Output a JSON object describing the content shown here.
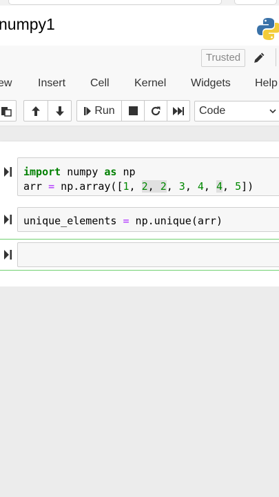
{
  "notebook": {
    "title": "numpy1"
  },
  "status": {
    "trusted_label": "Trusted"
  },
  "menu": [
    {
      "label": "ew"
    },
    {
      "label": "Insert"
    },
    {
      "label": "Cell"
    },
    {
      "label": "Kernel"
    },
    {
      "label": "Widgets"
    },
    {
      "label": "Help"
    }
  ],
  "toolbar": {
    "run_label": "Run",
    "cell_type": "Code"
  },
  "cells": [
    {
      "lines": [
        [
          {
            "t": "import",
            "c": "kw"
          },
          {
            "t": " numpy ",
            "c": ""
          },
          {
            "t": "as",
            "c": "kw"
          },
          {
            "t": " np",
            "c": ""
          }
        ],
        [
          {
            "t": "arr ",
            "c": ""
          },
          {
            "t": "=",
            "c": "op"
          },
          {
            "t": " np.array([",
            "c": ""
          },
          {
            "t": "1",
            "c": "num"
          },
          {
            "t": ", ",
            "c": ""
          },
          {
            "t": "2",
            "c": "num hl"
          },
          {
            "t": ", ",
            "c": "hl"
          },
          {
            "t": "2",
            "c": "num hl"
          },
          {
            "t": ", ",
            "c": ""
          },
          {
            "t": "3",
            "c": "num"
          },
          {
            "t": ", ",
            "c": ""
          },
          {
            "t": "4",
            "c": "num"
          },
          {
            "t": ", ",
            "c": ""
          },
          {
            "t": "4",
            "c": "num hl"
          },
          {
            "t": ", ",
            "c": ""
          },
          {
            "t": "5",
            "c": "num"
          },
          {
            "t": "])",
            "c": ""
          }
        ]
      ]
    },
    {
      "lines": [
        [
          {
            "t": "unique_elements ",
            "c": ""
          },
          {
            "t": "=",
            "c": "op"
          },
          {
            "t": " np.unique(arr)",
            "c": ""
          }
        ]
      ]
    },
    {
      "lines": []
    }
  ]
}
